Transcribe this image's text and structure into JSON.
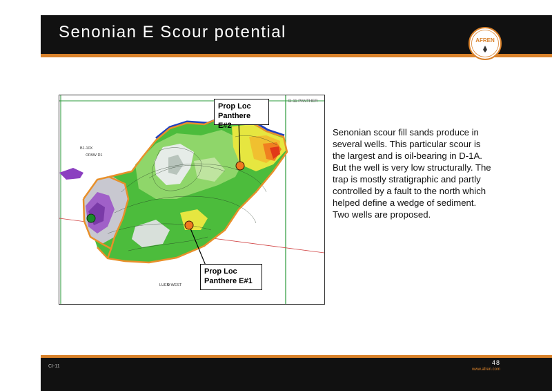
{
  "slide": {
    "title": "Senonian E Scour potential",
    "description": "Senonian scour fill sands produce in several wells. This particular scour is the largest and is oil-bearing in D-1A. But the well is very low structurally. The trap is mostly stratigraphic and partly controlled by a fault to the north which helped define a wedge of sediment. Two wells are proposed.",
    "page_number": "48",
    "footer_code": "CI-11",
    "footer_url": "www.afren.com",
    "logo_text": "AFREN"
  },
  "map": {
    "callout_top": {
      "line1": "Prop Loc",
      "line2": "Panthere E#2"
    },
    "callout_bottom": {
      "line1": "Prop Loc",
      "line2": "Panthere E#1"
    },
    "corner_label": "D-11 PANTHER",
    "well_labels": {
      "w1": "B1-10X",
      "w2": "PAW D1",
      "w3": "LUEN-WEST"
    }
  },
  "colors": {
    "accent": "#d9822b",
    "title_bar": "#111111",
    "scour_outline": "#e8902a",
    "fault_line": "#1f3fbf",
    "well_marker_proposed": "#f07a20",
    "well_marker_existing": "#1a8a2a"
  }
}
